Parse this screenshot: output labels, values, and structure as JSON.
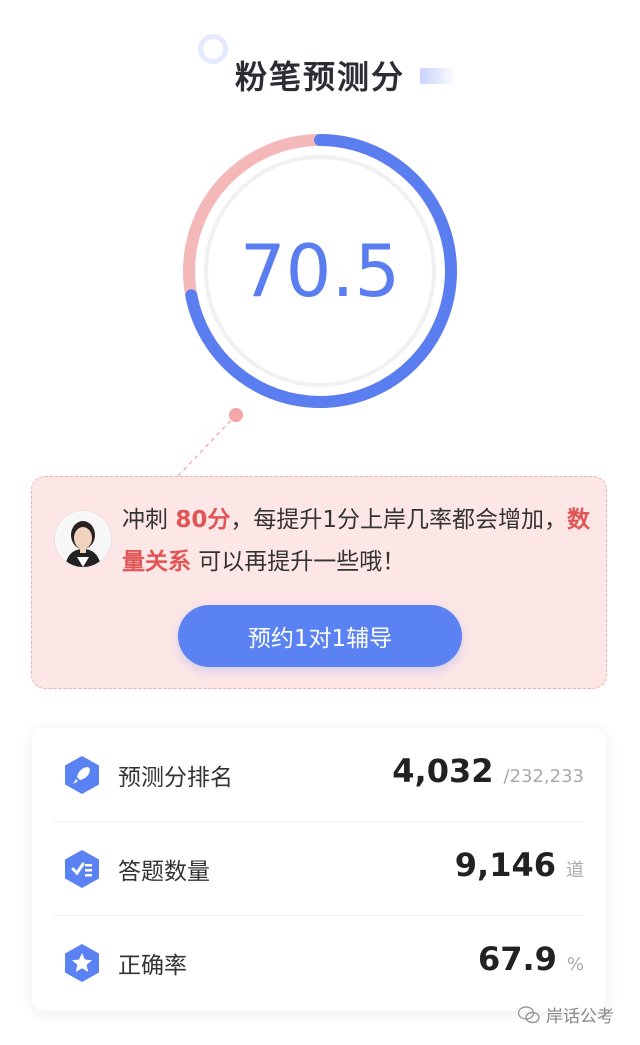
{
  "title": "粉笔预测分",
  "score": "70.5",
  "score_progress": 0.72,
  "colors": {
    "accent": "#5a7ef0",
    "highlight": "#e25555",
    "tip_bg": "#fde6e6",
    "gauge_rest": "#f4b8b8"
  },
  "tip": {
    "prefix": "冲刺 ",
    "target": "80分",
    "middle": "，每提升1分上岸几率都会增加，",
    "subject": "数量关系",
    "suffix": " 可以再提升一些哦！",
    "button": "预约1对1辅导"
  },
  "stats": [
    {
      "icon": "rocket-icon",
      "label": "预测分排名",
      "value": "4,032",
      "unit": "/232,233"
    },
    {
      "icon": "checklist-icon",
      "label": "答题数量",
      "value": "9,146",
      "unit": "道"
    },
    {
      "icon": "star-icon",
      "label": "正确率",
      "value": "67.9",
      "unit": "%"
    }
  ],
  "watermark": "岸话公考"
}
